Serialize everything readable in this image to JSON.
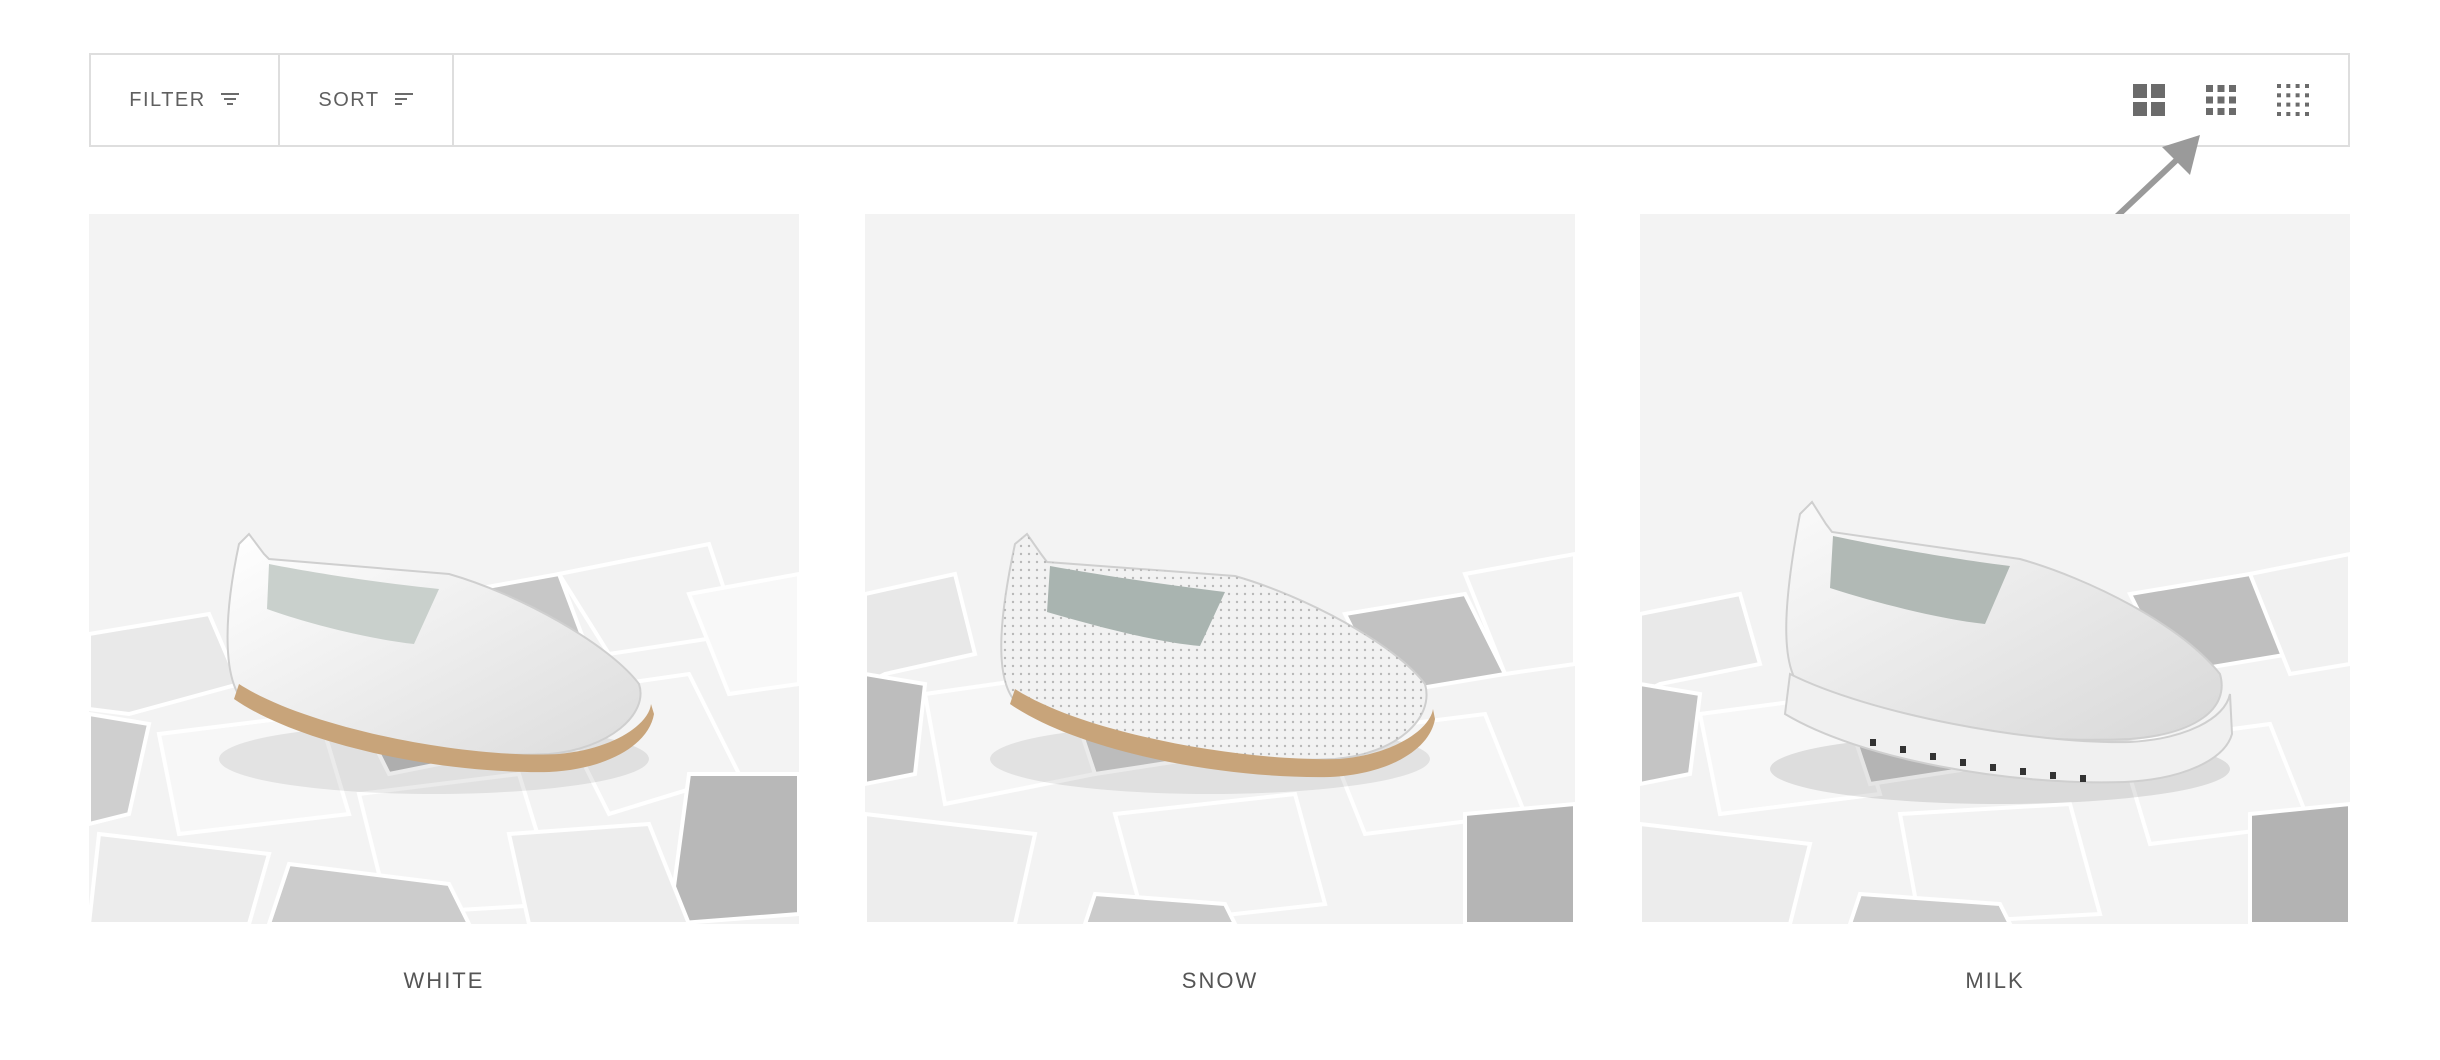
{
  "toolbar": {
    "filter_label": "FILTER",
    "sort_label": "SORT",
    "filter_icon": "filter-lines-icon",
    "sort_icon": "sort-lines-icon",
    "view_options": [
      {
        "name": "grid-2x2-view-icon"
      },
      {
        "name": "grid-3x3-view-icon"
      },
      {
        "name": "grid-4x4-view-icon"
      }
    ]
  },
  "products": [
    {
      "name": "WHITE",
      "image": "white leather slip-on shoe on broken tiles"
    },
    {
      "name": "SNOW",
      "image": "perforated white slip-on shoe on broken tiles"
    },
    {
      "name": "MILK",
      "image": "white platform slip-on shoe on broken tiles"
    }
  ],
  "colors": {
    "border": "#dedede",
    "text": "#555555",
    "icon": "#6b6b6b",
    "arrow": "#999999",
    "image_bg": "#f3f3f3"
  }
}
